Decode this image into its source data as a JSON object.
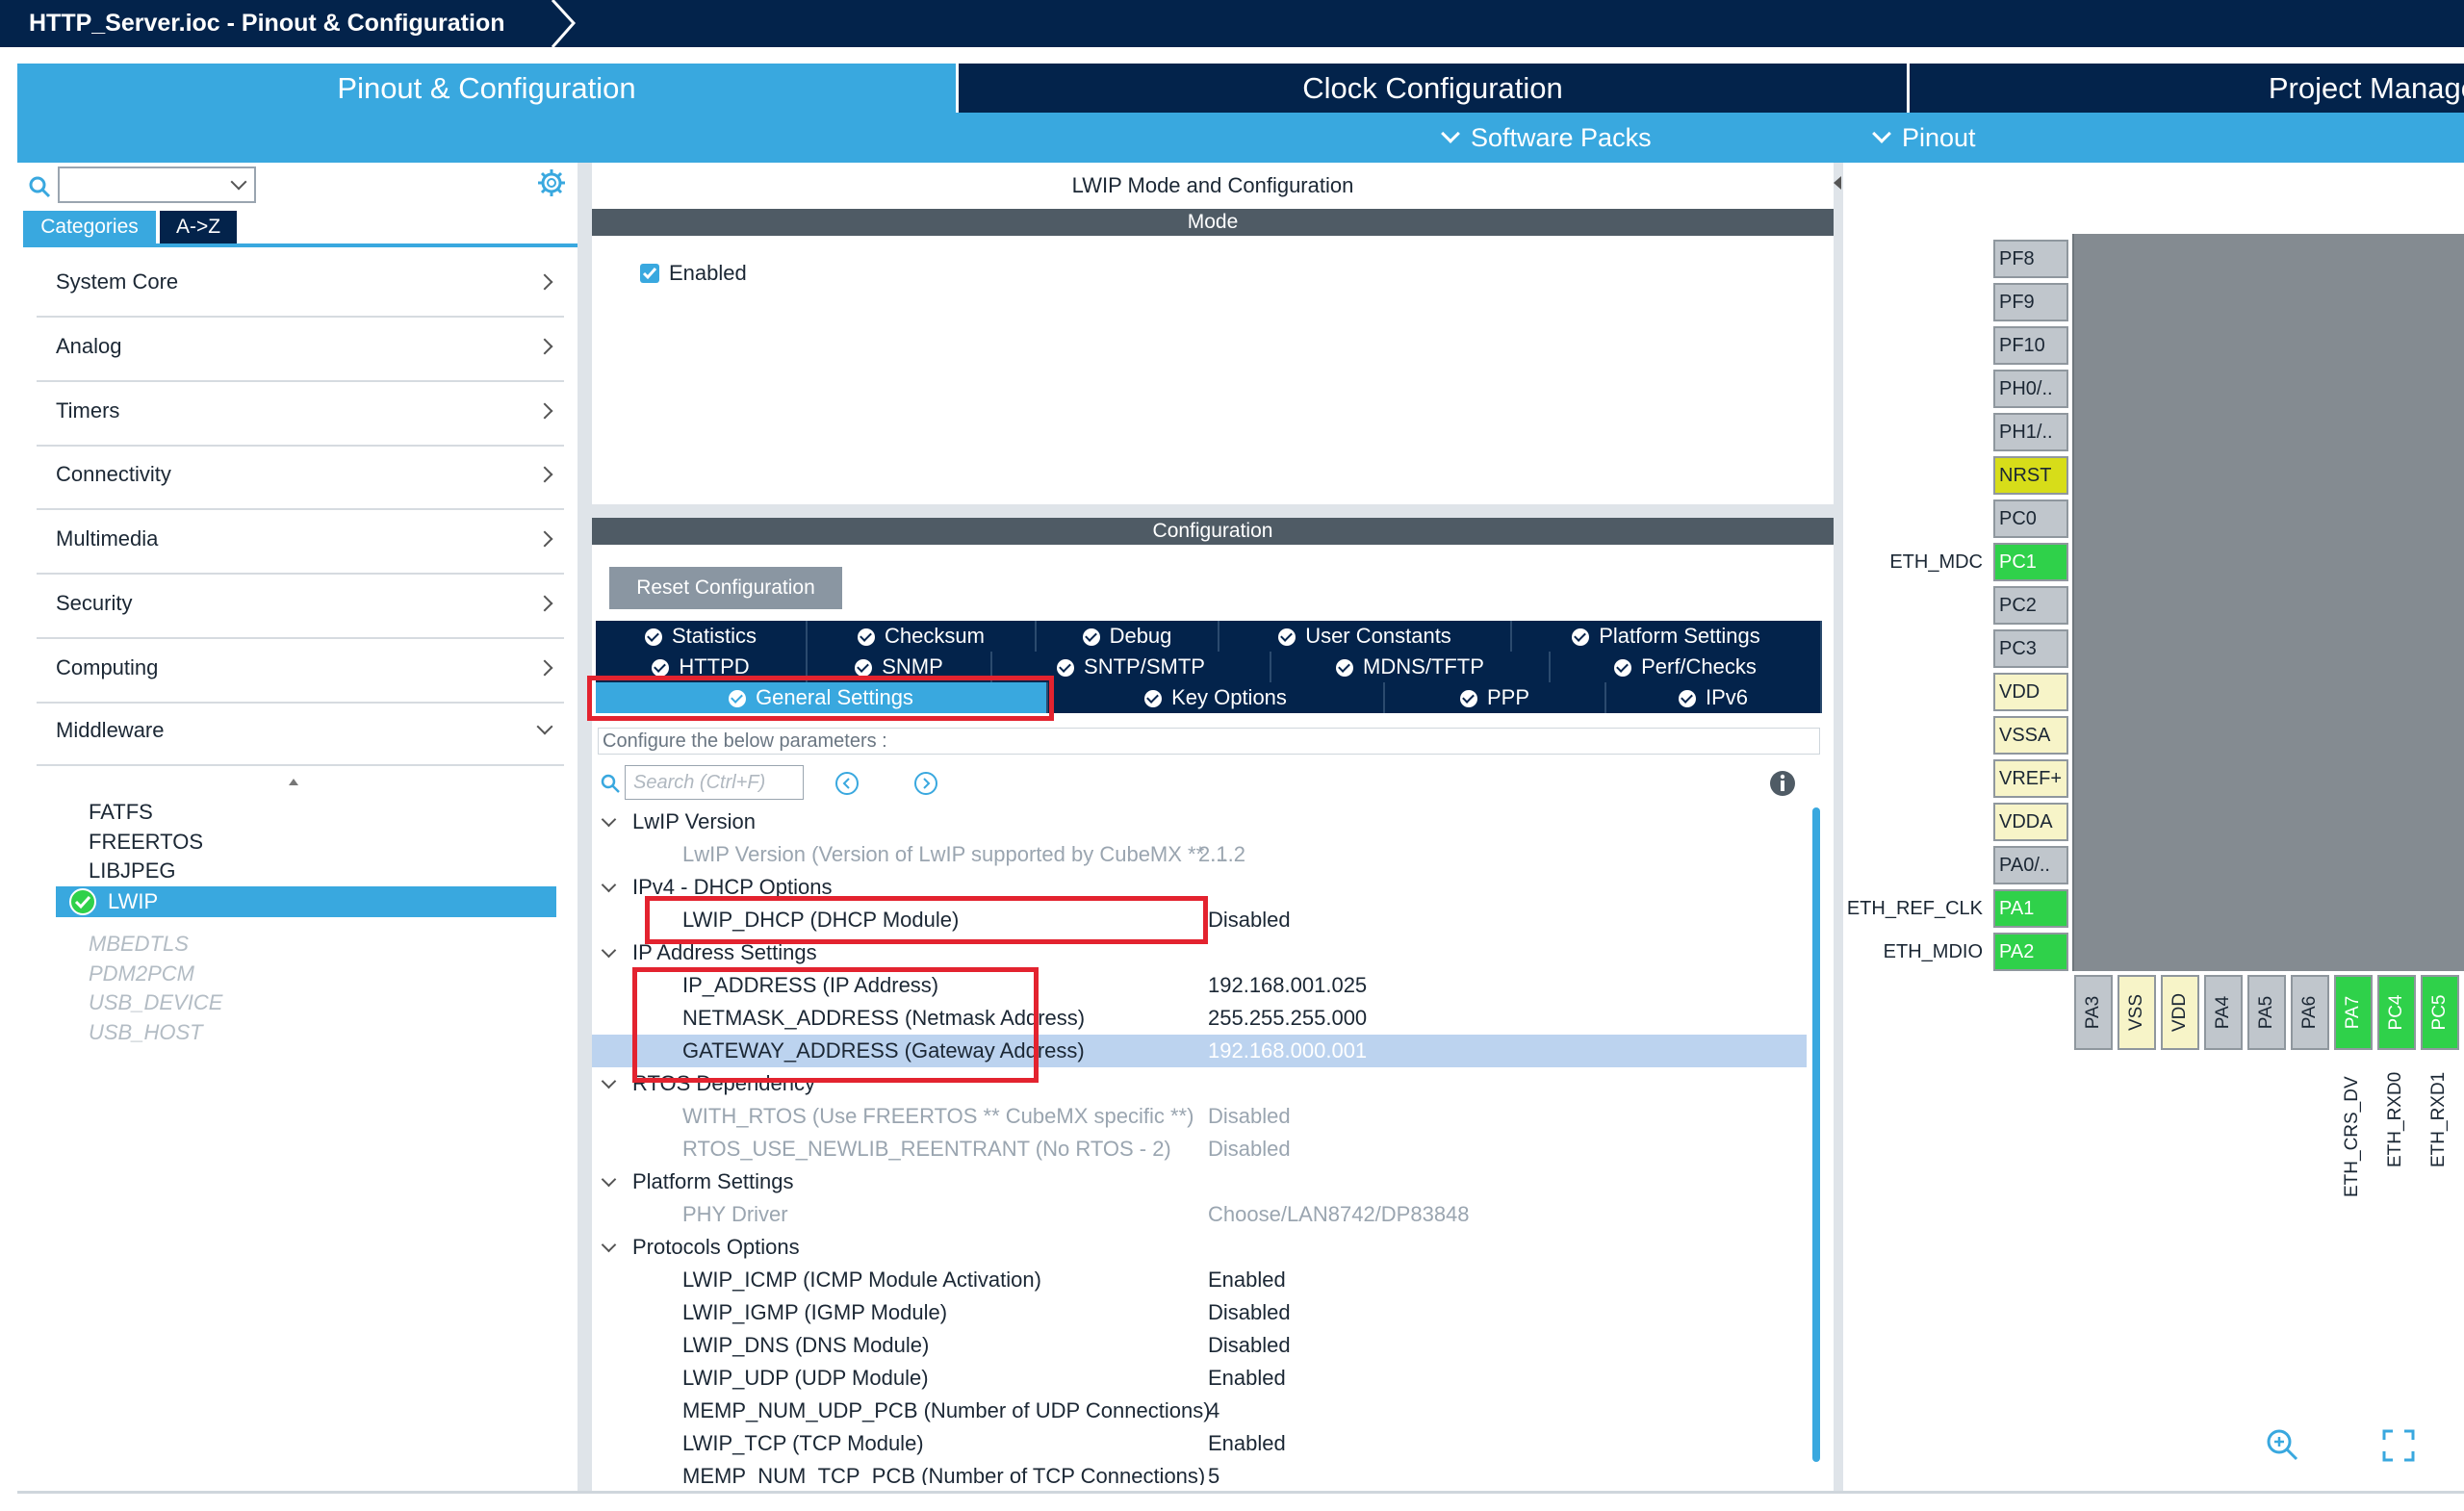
{
  "window": {
    "title": "HTTP_Server.ioc - Pinout & Configuration"
  },
  "main_tabs": [
    {
      "label": "Pinout & Configuration"
    },
    {
      "label": "Clock Configuration"
    },
    {
      "label": "Project Manage"
    }
  ],
  "subbar": {
    "software_packs": "Software Packs",
    "pinout": "Pinout"
  },
  "left": {
    "search_value": "",
    "tabs": [
      {
        "label": "Categories"
      },
      {
        "label": "A->Z"
      }
    ],
    "categories": [
      {
        "label": "System Core"
      },
      {
        "label": "Analog"
      },
      {
        "label": "Timers"
      },
      {
        "label": "Connectivity"
      },
      {
        "label": "Multimedia"
      },
      {
        "label": "Security"
      },
      {
        "label": "Computing"
      },
      {
        "label": "Middleware"
      }
    ],
    "middleware_items": [
      {
        "label": "FATFS",
        "state": "enabled"
      },
      {
        "label": "FREERTOS",
        "state": "enabled"
      },
      {
        "label": "LIBJPEG",
        "state": "enabled"
      },
      {
        "label": "LWIP",
        "state": "selected"
      },
      {
        "label": "MBEDTLS",
        "state": "disabled"
      },
      {
        "label": "PDM2PCM",
        "state": "disabled"
      },
      {
        "label": "USB_DEVICE",
        "state": "disabled"
      },
      {
        "label": "USB_HOST",
        "state": "disabled"
      }
    ]
  },
  "center": {
    "title": "LWIP Mode and Configuration",
    "mode_header": "Mode",
    "enabled_label": "Enabled",
    "config_header": "Configuration",
    "reset_button": "Reset Configuration",
    "tabs_row1": [
      "Statistics",
      "Checksum",
      "Debug",
      "User Constants",
      "Platform Settings"
    ],
    "tabs_row2": [
      "HTTPD",
      "SNMP",
      "SNTP/SMTP",
      "MDNS/TFTP",
      "Perf/Checks"
    ],
    "tabs_row3": [
      "General Settings",
      "Key Options",
      "PPP",
      "IPv6"
    ],
    "hint": "Configure the below parameters :",
    "search_placeholder": "Search (Ctrl+F)",
    "params": [
      {
        "kind": "section",
        "name": "LwIP Version"
      },
      {
        "kind": "param",
        "name": "LwIP Version (Version of LwIP supported by CubeMX ** ...",
        "value": "2.1.2",
        "readonly": true
      },
      {
        "kind": "section",
        "name": "IPv4 - DHCP Options"
      },
      {
        "kind": "param",
        "name": "LWIP_DHCP (DHCP Module)",
        "value": "Disabled",
        "readonly": false
      },
      {
        "kind": "section",
        "name": "IP Address Settings"
      },
      {
        "kind": "param",
        "name": "IP_ADDRESS (IP Address)",
        "value": "192.168.001.025",
        "readonly": false
      },
      {
        "kind": "param",
        "name": "NETMASK_ADDRESS (Netmask Address)",
        "value": "255.255.255.000",
        "readonly": false
      },
      {
        "kind": "param",
        "name": "GATEWAY_ADDRESS (Gateway Address)",
        "value": "192.168.000.001",
        "readonly": false,
        "selected": true
      },
      {
        "kind": "section",
        "name": "RTOS Dependency"
      },
      {
        "kind": "param",
        "name": "WITH_RTOS (Use FREERTOS ** CubeMX specific **)",
        "value": "Disabled",
        "readonly": true
      },
      {
        "kind": "param",
        "name": "RTOS_USE_NEWLIB_REENTRANT (No RTOS - 2)",
        "value": "Disabled",
        "readonly": true
      },
      {
        "kind": "section",
        "name": "Platform Settings"
      },
      {
        "kind": "param",
        "name": "PHY Driver",
        "value": "Choose/LAN8742/DP83848",
        "readonly": true
      },
      {
        "kind": "section",
        "name": "Protocols Options"
      },
      {
        "kind": "param",
        "name": "LWIP_ICMP (ICMP Module Activation)",
        "value": "Enabled",
        "readonly": false
      },
      {
        "kind": "param",
        "name": "LWIP_IGMP (IGMP Module)",
        "value": "Disabled",
        "readonly": false
      },
      {
        "kind": "param",
        "name": "LWIP_DNS (DNS Module)",
        "value": "Disabled",
        "readonly": false
      },
      {
        "kind": "param",
        "name": "LWIP_UDP (UDP Module)",
        "value": "Enabled",
        "readonly": false
      },
      {
        "kind": "param",
        "name": "MEMP_NUM_UDP_PCB (Number of UDP Connections)",
        "value": "4",
        "readonly": false
      },
      {
        "kind": "param",
        "name": "LWIP_TCP (TCP Module)",
        "value": "Enabled",
        "readonly": false
      },
      {
        "kind": "param",
        "name": "MEMP_NUM_TCP_PCB (Number of TCP Connections)",
        "value": "5",
        "readonly": false
      }
    ]
  },
  "pinout": {
    "left_pins": [
      {
        "name": "PF8",
        "state": "default",
        "label": ""
      },
      {
        "name": "PF9",
        "state": "default",
        "label": ""
      },
      {
        "name": "PF10",
        "state": "default",
        "label": ""
      },
      {
        "name": "PH0/..",
        "state": "default",
        "label": ""
      },
      {
        "name": "PH1/..",
        "state": "default",
        "label": ""
      },
      {
        "name": "NRST",
        "state": "yellow",
        "label": ""
      },
      {
        "name": "PC0",
        "state": "default",
        "label": ""
      },
      {
        "name": "PC1",
        "state": "green",
        "label": "ETH_MDC"
      },
      {
        "name": "PC2",
        "state": "default",
        "label": ""
      },
      {
        "name": "PC3",
        "state": "default",
        "label": ""
      },
      {
        "name": "VDD",
        "state": "cream",
        "label": ""
      },
      {
        "name": "VSSA",
        "state": "cream",
        "label": ""
      },
      {
        "name": "VREF+",
        "state": "cream",
        "label": ""
      },
      {
        "name": "VDDA",
        "state": "cream",
        "label": ""
      },
      {
        "name": "PA0/..",
        "state": "default",
        "label": ""
      },
      {
        "name": "PA1",
        "state": "green",
        "label": "ETH_REF_CLK"
      },
      {
        "name": "PA2",
        "state": "green",
        "label": "ETH_MDIO"
      }
    ],
    "bottom_pins": [
      {
        "name": "PA3",
        "state": "default"
      },
      {
        "name": "VSS",
        "state": "cream"
      },
      {
        "name": "VDD",
        "state": "cream"
      },
      {
        "name": "PA4",
        "state": "default"
      },
      {
        "name": "PA5",
        "state": "default"
      },
      {
        "name": "PA6",
        "state": "default"
      },
      {
        "name": "PA7",
        "state": "green"
      },
      {
        "name": "PC4",
        "state": "green"
      },
      {
        "name": "PC5",
        "state": "green"
      }
    ],
    "bottom_labels": [
      "ETH_CRS_DV",
      "ETH_RXD0",
      "ETH_RXD1"
    ]
  },
  "colors": {
    "navy": "#03234b",
    "accent": "#39a8df",
    "pin_green": "#2fd14a",
    "pin_yellow": "#d7dd19",
    "highlight": "#e3232f"
  }
}
